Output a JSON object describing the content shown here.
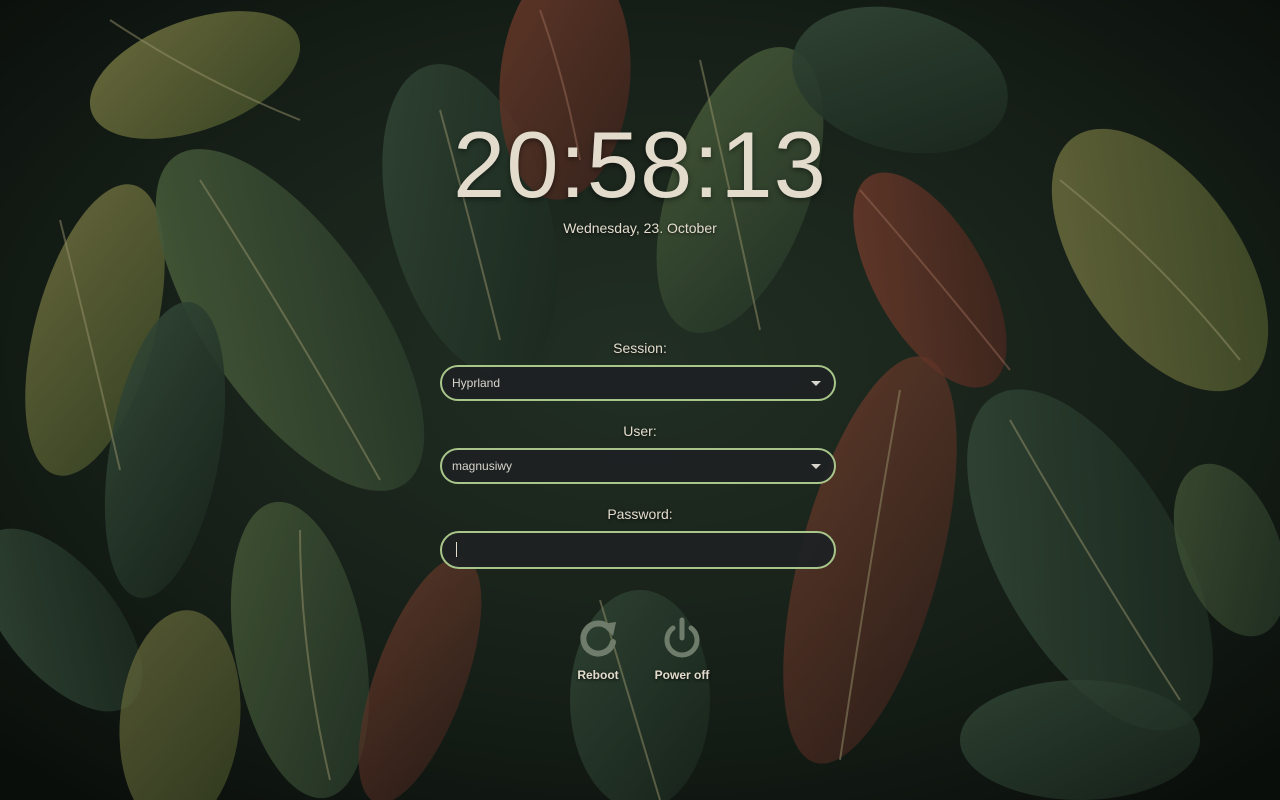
{
  "clock": {
    "time": "20:58:13",
    "date": "Wednesday, 23. October"
  },
  "session": {
    "label": "Session:",
    "value": "Hyprland",
    "icon": "chevron-down-icon"
  },
  "user": {
    "label": "User:",
    "value": "magnusiwy",
    "icon": "chevron-down-icon"
  },
  "password": {
    "label": "Password:",
    "value": ""
  },
  "power": {
    "reboot_label": "Reboot",
    "reboot_icon": "reboot-icon",
    "poweroff_label": "Power off",
    "poweroff_icon": "power-icon"
  },
  "colors": {
    "accent_border": "#a8c58a",
    "text": "#e3dccd",
    "field_bg": "#1e2123",
    "icon": "#6f7c6b"
  }
}
